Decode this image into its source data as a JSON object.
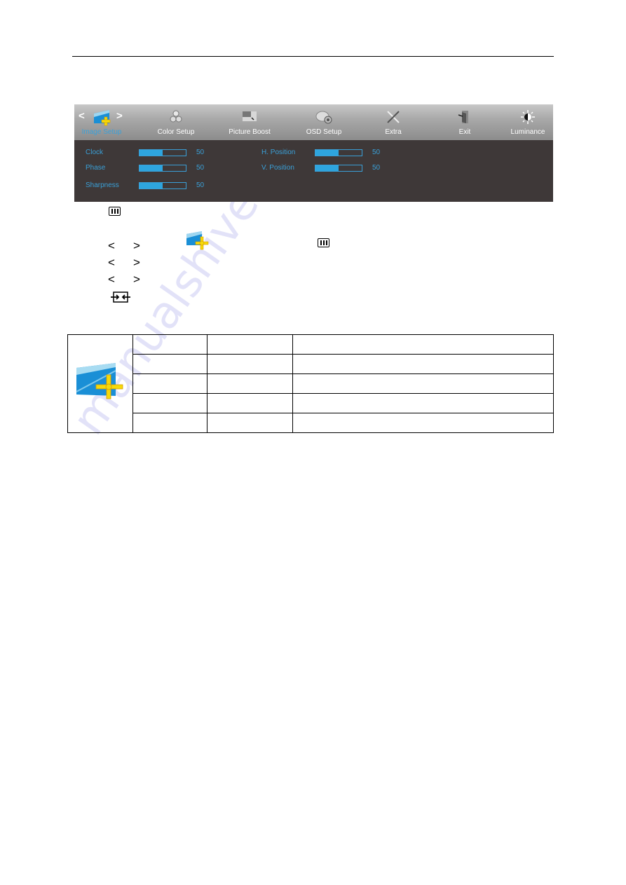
{
  "osd": {
    "tabs": [
      {
        "label": "Image Setup",
        "icon": "image-setup-icon",
        "active": true
      },
      {
        "label": "Color Setup",
        "icon": "color-setup-icon",
        "active": false
      },
      {
        "label": "Picture Boost",
        "icon": "picture-boost-icon",
        "active": false
      },
      {
        "label": "OSD Setup",
        "icon": "osd-setup-icon",
        "active": false
      },
      {
        "label": "Extra",
        "icon": "extra-icon",
        "active": false
      },
      {
        "label": "Exit",
        "icon": "exit-icon",
        "active": false
      },
      {
        "label": "Luminance",
        "icon": "luminance-icon",
        "active": false
      }
    ],
    "nav_left": "<",
    "nav_right": ">",
    "settings": [
      {
        "name": "Clock",
        "value": "50",
        "level": 50
      },
      {
        "name": "Phase",
        "value": "50",
        "level": 50
      },
      {
        "name": "Sharpness",
        "value": "50",
        "level": 50
      },
      {
        "name": "H. Position",
        "value": "50",
        "level": 50
      },
      {
        "name": "V. Position",
        "value": "50",
        "level": 50
      }
    ],
    "colors": {
      "accent": "#2ea5de",
      "label": "#3aa0d8",
      "body_bg": "#3e3838"
    }
  },
  "instructions": {
    "left_chevron": "<",
    "right_chevron": ">",
    "icons": [
      "menu-button-icon",
      "image-setup-icon",
      "menu-button-icon",
      "source-enter-icon"
    ]
  },
  "table": {
    "rows": 5,
    "icon": "image-setup-icon"
  },
  "watermark": "manualshive.com"
}
